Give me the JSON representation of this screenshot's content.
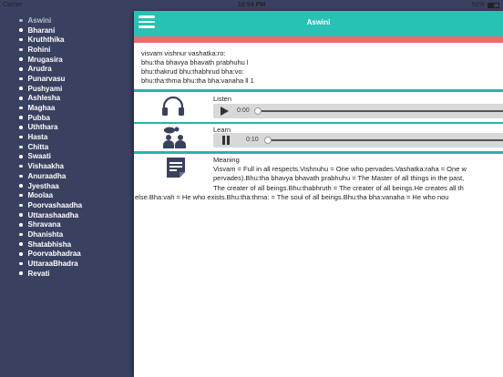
{
  "status": {
    "carrier": "Carrier",
    "time": "10:54 PM",
    "battery": "51%"
  },
  "sidebar": {
    "items": [
      "Aswini",
      "Bharani",
      "Kruththika",
      "Rohini",
      "Mrugasira",
      "Arudra",
      "Punarvasu",
      "Pushyami",
      "Ashlesha",
      "Maghaa",
      "Pubba",
      "Uththara",
      "Hasta",
      "Chitta",
      "Swaati",
      "Vishaakha",
      "Anuraadha",
      "Jyesthaa",
      "Moolaa",
      "Poorvashaadha",
      "Uttarashaadha",
      "Shravana",
      "Dhanishta",
      "Shatabhisha",
      "Poorvabhadraa",
      "UttaraaBhadra",
      "Revati"
    ],
    "active_index": 0
  },
  "header": {
    "title": "Aswini",
    "menu_icon": "hamburger-menu-icon"
  },
  "verse": {
    "lines": [
      "visvam vishnur vashatka:ro:",
      "bhu:tha bhavya bhavath prabhuhu l",
      "bhu:thakrud bhu:thabhrud bha:vo:",
      "bhu:tha:thma bhu:tha bha:vanaha ll 1"
    ]
  },
  "listen": {
    "label": "Listen",
    "icon": "headphones-icon",
    "control": "play-icon",
    "time": "0:00",
    "progress": 0.0
  },
  "learn": {
    "label": "Learn",
    "icon": "people-icon",
    "control": "pause-icon",
    "time": "0:10",
    "progress": 0.0
  },
  "meaning": {
    "label": "Meaning",
    "icon": "document-icon",
    "lines": [
      "Visvam = Full in all respects.Vishnuhu = One who pervades.Vashatka:raha = One w",
      "pervades).Bhu:tha bhavya bhavath prabhuhu = The Master of all things in the past,",
      "The creater of all beings.Bhu:thabhruth = The creater of all beings.He creates all th",
      "else.Bha:vah = He who exists.Bhu:tha:thma: = The soul of all beings.Bhu:tha bha:vanaha = He who nou"
    ]
  },
  "colors": {
    "teal": "#27c2b4",
    "accent_red": "#ee6a6e",
    "sidebar_bg": "#3a4160",
    "icon": "#3a4160"
  }
}
